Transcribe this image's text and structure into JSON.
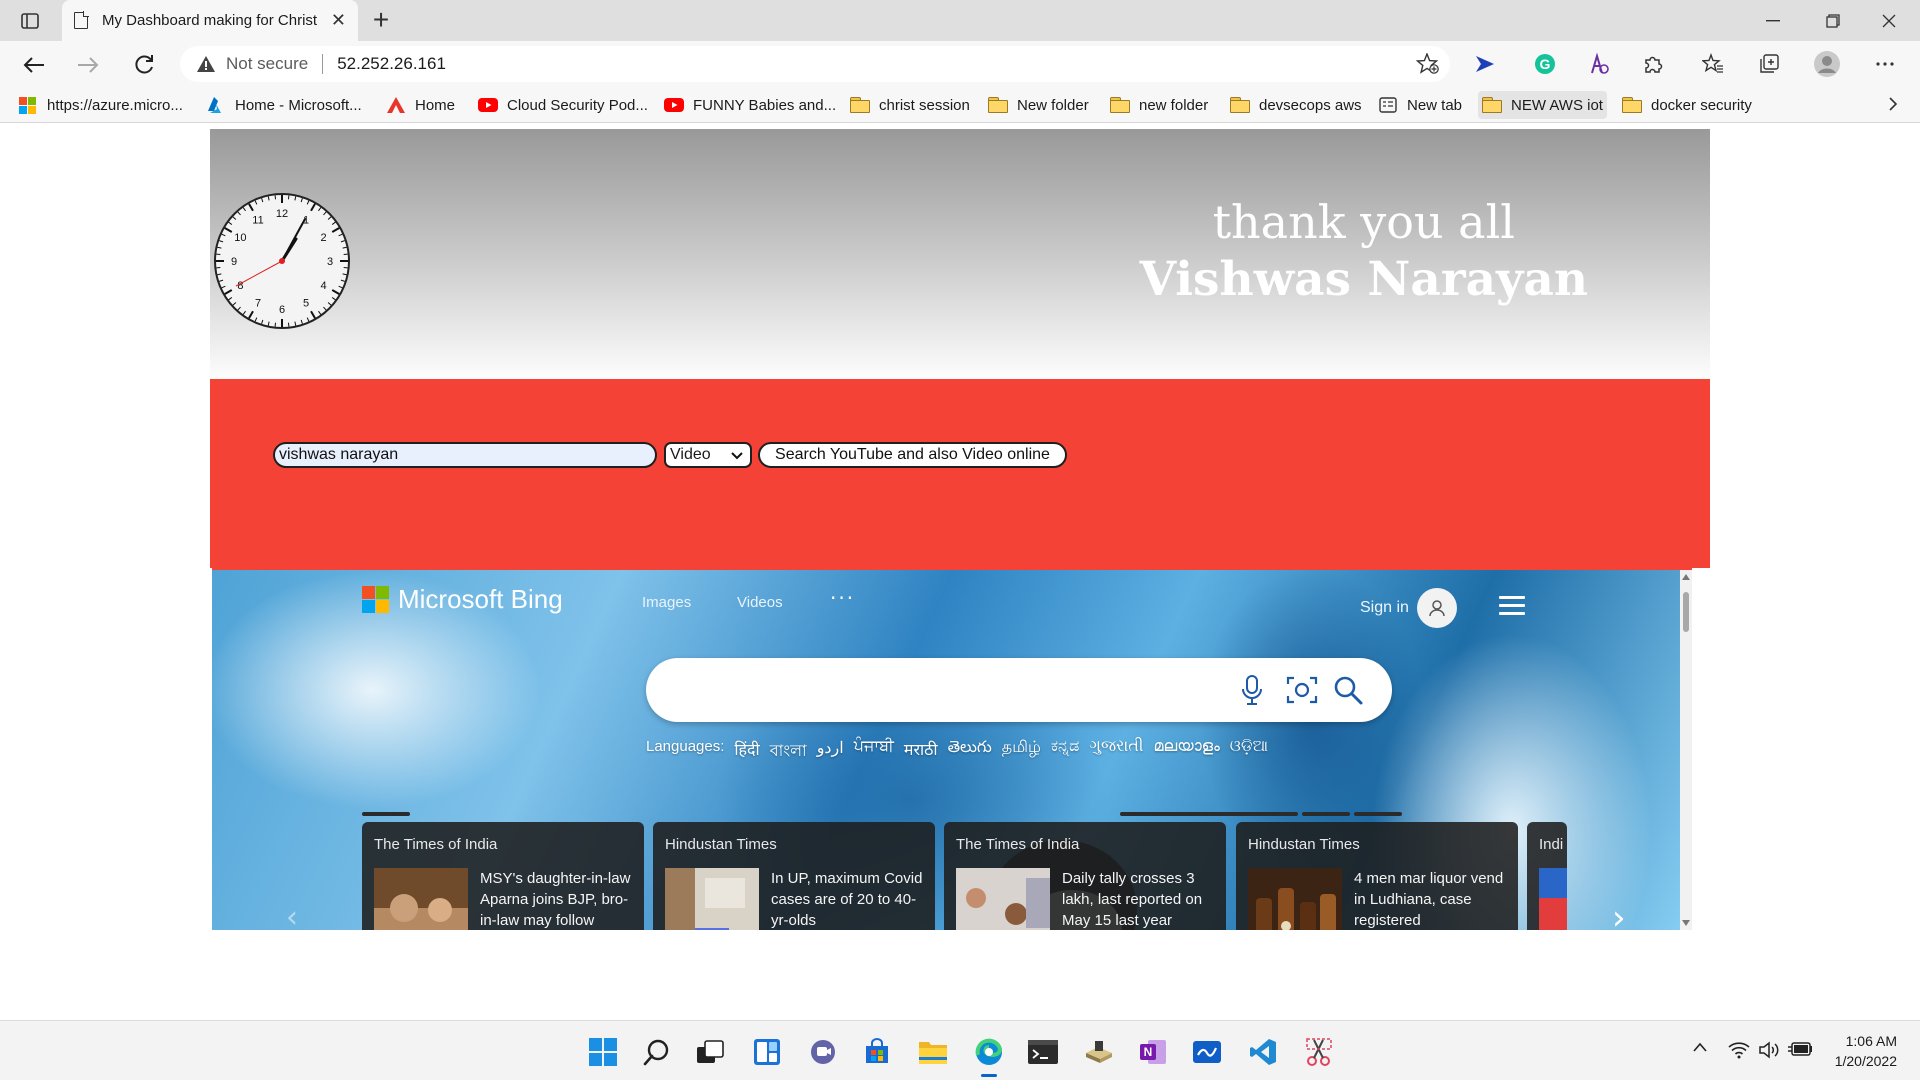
{
  "browser": {
    "tab_title": "My Dashboard making for Christ",
    "not_secure": "Not secure",
    "url": "52.252.26.161"
  },
  "bookmarks": [
    {
      "label": "https://azure.micro...",
      "icon": "microsoft-logo-icon"
    },
    {
      "label": "Home - Microsoft...",
      "icon": "azure-icon"
    },
    {
      "label": "Home",
      "icon": "a-logo-icon"
    },
    {
      "label": "Cloud Security Pod...",
      "icon": "youtube-icon"
    },
    {
      "label": "FUNNY Babies and...",
      "icon": "youtube-icon"
    },
    {
      "label": "christ session",
      "icon": "folder-icon"
    },
    {
      "label": "New folder",
      "icon": "folder-icon"
    },
    {
      "label": "new folder",
      "icon": "folder-icon"
    },
    {
      "label": "devsecops aws",
      "icon": "folder-icon"
    },
    {
      "label": "New tab",
      "icon": "new-tab-icon"
    },
    {
      "label": "NEW AWS iot",
      "icon": "folder-icon"
    },
    {
      "label": "docker security",
      "icon": "folder-icon"
    }
  ],
  "header": {
    "line1": "thank you all",
    "line2": "Vishwas Narayan"
  },
  "clock_numbers": [
    "12",
    "1",
    "2",
    "3",
    "4",
    "5",
    "6",
    "7",
    "8",
    "9",
    "10",
    "11"
  ],
  "search_form": {
    "query": "vishwas narayan",
    "select_value": "Video",
    "button_label": "Search YouTube and also Video online"
  },
  "bing": {
    "brand": "Microsoft Bing",
    "nav": [
      "Images",
      "Videos"
    ],
    "more": "···",
    "signin": "Sign in",
    "languages_label": "Languages:",
    "languages": [
      "हिंदी",
      "বাংলা",
      "اردو",
      "ਪੰਜਾਬੀ",
      "मराठी",
      "తెలుగు",
      "தமிழ்",
      "ಕನ್ನಡ",
      "ગુજરાતી",
      "മലയാളം",
      "ଓଡ଼ିଆ"
    ],
    "news": [
      {
        "source": "The Times of India",
        "headline": "MSY's daughter-in-law Aparna joins BJP, bro-in-law may follow"
      },
      {
        "source": "Hindustan Times",
        "headline": "In UP, maximum Covid cases are of 20 to 40-yr-olds"
      },
      {
        "source": "The Times of India",
        "headline": "Daily tally crosses 3 lakh, last reported on May 15 last year"
      },
      {
        "source": "Hindustan Times",
        "headline": "4 men mar liquor vend in Ludhiana, case registered"
      },
      {
        "source": "Indi",
        "headline": ""
      }
    ]
  },
  "taskbar": {
    "time": "1:06 AM",
    "date": "1/20/2022"
  },
  "colors": {
    "red_panel": "#f44336",
    "accent": "#0a64c8"
  }
}
